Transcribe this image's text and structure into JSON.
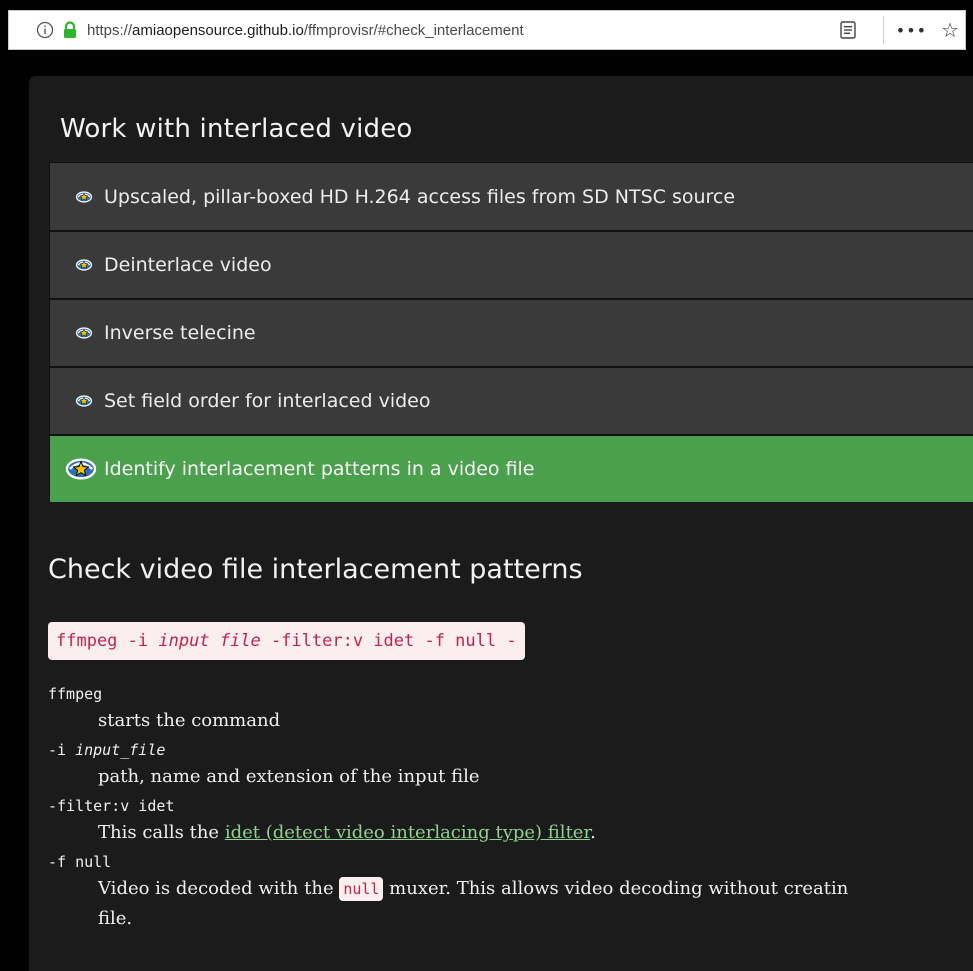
{
  "browser": {
    "url_prefix": "https://",
    "url_host": "amiaopensource.github.io",
    "url_path": "/ffmprovisr/#check_interlacement",
    "more_label": "•••",
    "star_glyph": "☆"
  },
  "section": {
    "title": "Work with interlaced video",
    "recipes": [
      {
        "label": "Upscaled, pillar-boxed HD H.264 access files from SD NTSC source",
        "active": false
      },
      {
        "label": "Deinterlace video",
        "active": false
      },
      {
        "label": "Inverse telecine",
        "active": false
      },
      {
        "label": "Set field order for interlaced video",
        "active": false
      },
      {
        "label": "Identify interlacement patterns in a video file",
        "active": true
      }
    ]
  },
  "recipe": {
    "heading": "Check video file interlacement patterns",
    "command": {
      "part1": "ffmpeg -i ",
      "part2_italic": "input file",
      "part3": " -filter:v idet -f null -"
    },
    "terms": [
      {
        "term": "ffmpeg",
        "desc": "starts the command"
      },
      {
        "term_prefix": "-i ",
        "term_italic": "input_file",
        "desc": "path, name and extension of the input file"
      },
      {
        "term": "-filter:v idet",
        "desc_prefix": "This calls the ",
        "desc_link": "idet (detect video interlacing type) filter",
        "desc_suffix": "."
      },
      {
        "term": "-f null",
        "desc_prefix": "Video is decoded with the ",
        "desc_code": "null",
        "desc_suffix": " muxer. This allows video decoding without creatin",
        "desc_line2": "file."
      }
    ]
  },
  "colors": {
    "page_bg": "#1b1b1b",
    "recipe_bg": "#3a3a3a",
    "active_bg": "#4aa04d",
    "code_bg": "#fbeef0",
    "code_fg": "#c3234d",
    "link": "#8fd18f",
    "lock": "#2db52d"
  }
}
